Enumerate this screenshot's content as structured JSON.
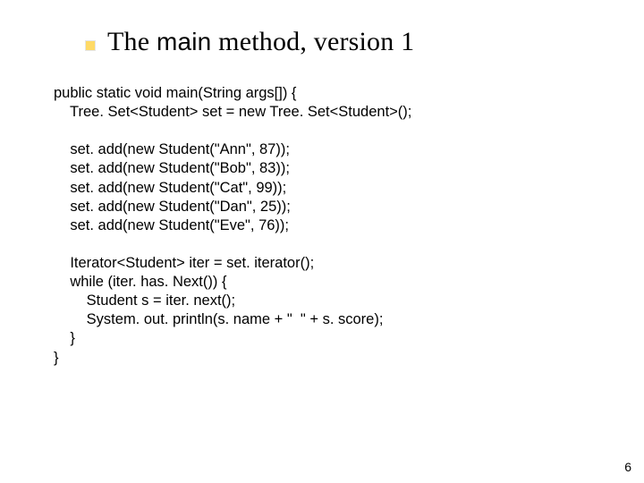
{
  "title": {
    "prefix": "The ",
    "keyword": "main",
    "suffix": " method, version 1"
  },
  "code": {
    "l1": "public static void main(String args[]) {",
    "l2": "    Tree. Set<Student> set = new Tree. Set<Student>();",
    "l3": "",
    "l4": "    set. add(new Student(\"Ann\", 87));",
    "l5": "    set. add(new Student(\"Bob\", 83));",
    "l6": "    set. add(new Student(\"Cat\", 99));",
    "l7": "    set. add(new Student(\"Dan\", 25));",
    "l8": "    set. add(new Student(\"Eve\", 76));",
    "l9": "",
    "l10": "    Iterator<Student> iter = set. iterator();",
    "l11": "    while (iter. has. Next()) {",
    "l12": "        Student s = iter. next();",
    "l13": "        System. out. println(s. name + \"  \" + s. score);",
    "l14": "    }",
    "l15": "}"
  },
  "page_number": "6"
}
